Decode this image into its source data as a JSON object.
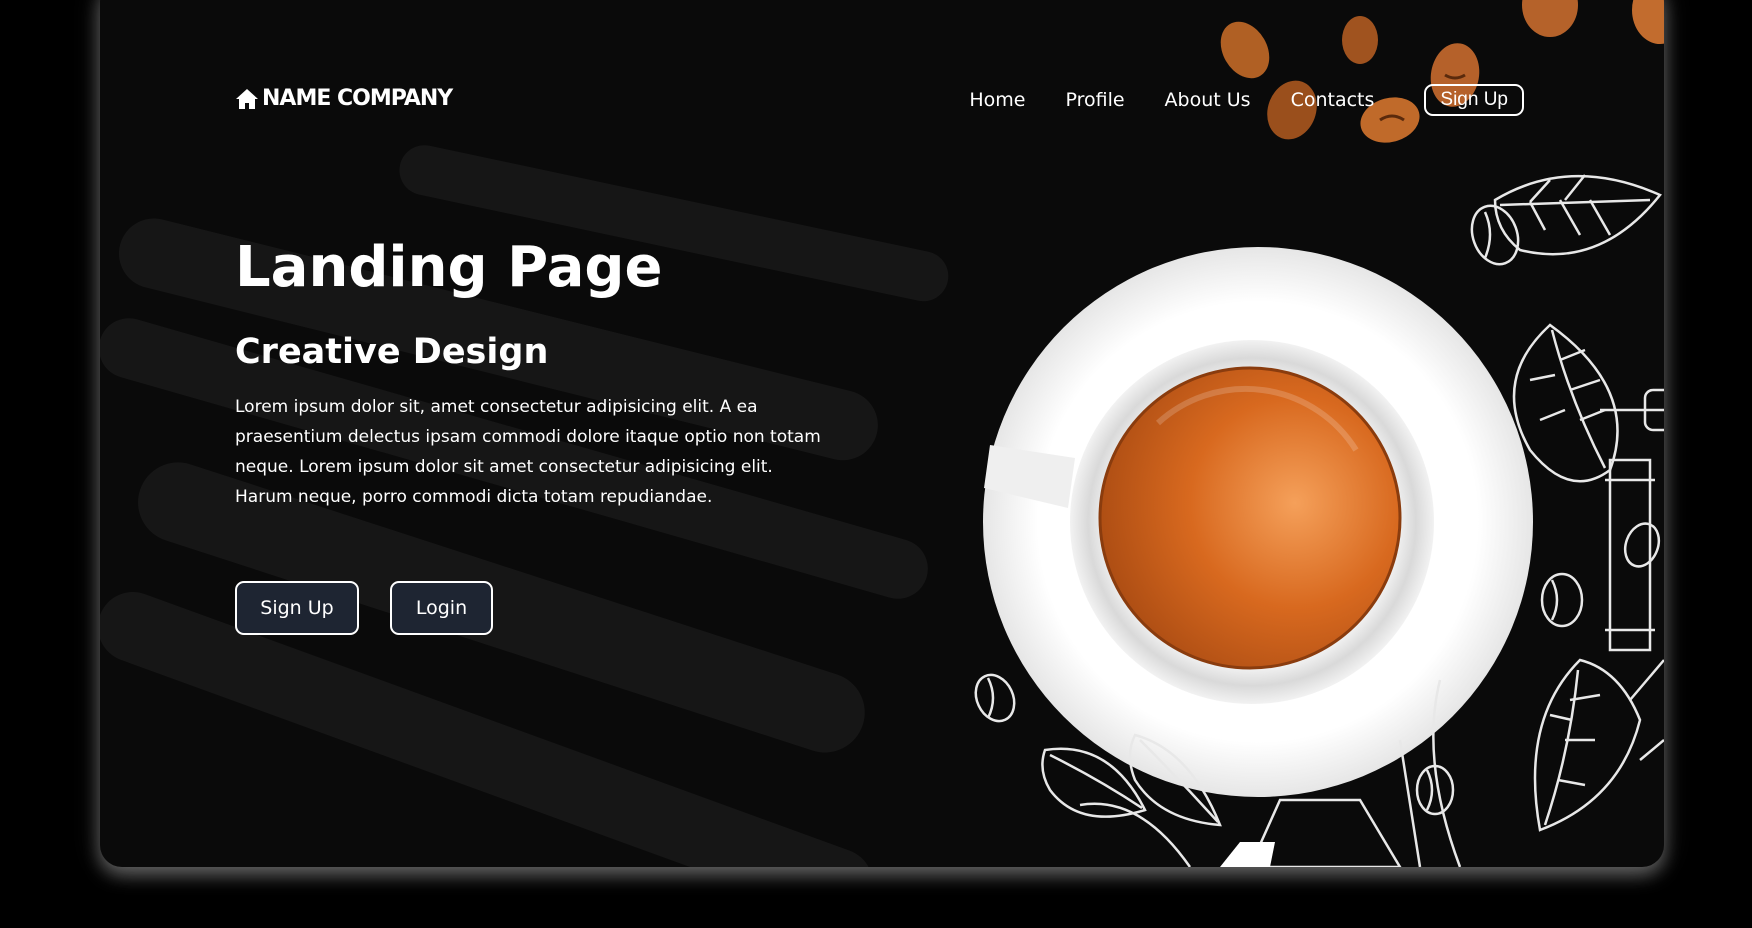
{
  "brand": {
    "name": "NAME COMPANY",
    "logo_icon": "home-icon"
  },
  "nav": {
    "links": [
      "Home",
      "Profile",
      "About Us",
      "Contacts"
    ],
    "signup_label": "Sign Up"
  },
  "hero": {
    "title": "Landing Page",
    "subtitle": "Creative Design",
    "description": "Lorem ipsum dolor sit, amet consectetur adipisicing elit. A ea praesentium delectus ipsam commodi dolore itaque optio non totam neque. Lorem ipsum dolor sit amet consectetur adipisicing elit. Harum neque, porro commodi dicta totam repudiandae.",
    "signup_label": "Sign Up",
    "login_label": "Login"
  },
  "colors": {
    "background": "#000000",
    "card": "#0a0a0a",
    "button_bg": "#1e2532",
    "coffee": "#d2691e",
    "text": "#ffffff"
  }
}
